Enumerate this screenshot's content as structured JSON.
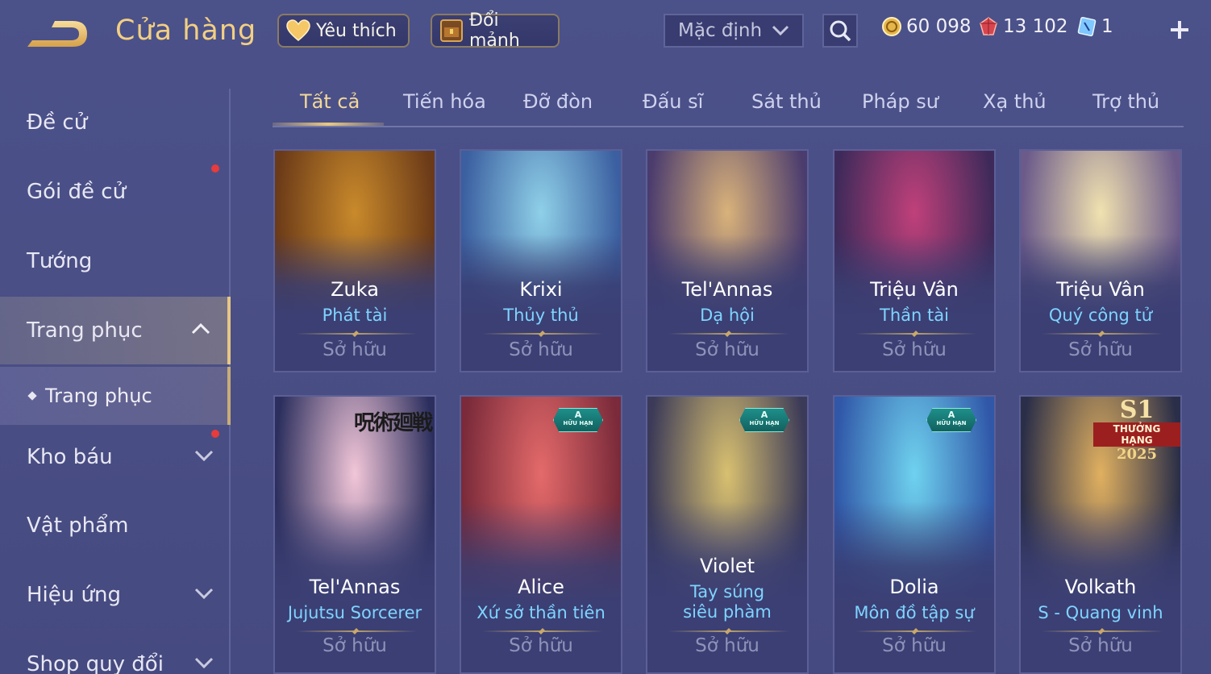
{
  "header": {
    "title": "Cửa hàng",
    "favorite_label": "Yêu thích",
    "trade_label": "Đổi mảnh",
    "sort_value": "Mặc định",
    "currencies": [
      {
        "icon": "gold-coin-icon",
        "value": "60 098"
      },
      {
        "icon": "ruby-icon",
        "value": "13 102"
      },
      {
        "icon": "voucher-icon",
        "value": "1"
      }
    ]
  },
  "sidebar": {
    "items": [
      {
        "label": "Đề cử"
      },
      {
        "label": "Gói đề cử"
      },
      {
        "label": "Tướng"
      },
      {
        "label": "Trang phục"
      },
      {
        "label": "Kho báu"
      },
      {
        "label": "Vật phẩm"
      },
      {
        "label": "Hiệu ứng"
      },
      {
        "label": "Shop quy đổi"
      }
    ],
    "sub_item": "Trang phục"
  },
  "tabs": [
    "Tất cả",
    "Tiến hóa",
    "Đỡ đòn",
    "Đấu sĩ",
    "Sát thủ",
    "Pháp sư",
    "Xạ thủ",
    "Trợ thủ"
  ],
  "cards": [
    {
      "hero": "Zuka",
      "skin": "Phát tài",
      "status": "Sở hữu",
      "art_colors": [
        "#c98a2b",
        "#6b3a18"
      ]
    },
    {
      "hero": "Krixi",
      "skin": "Thủy thủ",
      "status": "Sở hữu",
      "art_colors": [
        "#8fd0e8",
        "#3b5fa0"
      ]
    },
    {
      "hero": "Tel'Annas",
      "skin": "Dạ hội",
      "status": "Sở hữu",
      "art_colors": [
        "#d9b27a",
        "#4b3c6e"
      ]
    },
    {
      "hero": "Triệu Vân",
      "skin": "Thần tài",
      "status": "Sở hữu",
      "art_colors": [
        "#c0407a",
        "#3e2a5a"
      ]
    },
    {
      "hero": "Triệu Vân",
      "skin": "Quý công tử",
      "status": "Sở hữu",
      "art_colors": [
        "#f1e2b0",
        "#6b5a8a"
      ]
    },
    {
      "hero": "Tel'Annas",
      "skin": "Jujutsu Sorcerer",
      "status": "Sở hữu",
      "art_colors": [
        "#f2c6d8",
        "#2c2f5e"
      ],
      "watermark": "呪術廻戦"
    },
    {
      "hero": "Alice",
      "skin": "Xứ sở thần tiên",
      "status": "Sở hữu",
      "art_colors": [
        "#e46a6a",
        "#7a2a3a"
      ],
      "badge": {
        "tier": "A",
        "label": "HỮU HẠN"
      }
    },
    {
      "hero": "Violet",
      "skin": "Tay súng siêu phàm",
      "status": "Sở hữu",
      "art_colors": [
        "#d8c070",
        "#3b3a58"
      ],
      "badge": {
        "tier": "A",
        "label": "HỮU HẠN"
      }
    },
    {
      "hero": "Dolia",
      "skin": "Môn đồ tập sự",
      "status": "Sở hữu",
      "art_colors": [
        "#6fd2ef",
        "#3057a8"
      ],
      "badge": {
        "tier": "A",
        "label": "HỮU HẠN"
      }
    },
    {
      "hero": "Volkath",
      "skin": "S - Quang vinh",
      "status": "Sở hữu",
      "art_colors": [
        "#e0b060",
        "#2a2e48"
      ],
      "season": {
        "title": "S1",
        "rank": "THƯỞNG HẠNG",
        "year": "2025"
      }
    }
  ]
}
